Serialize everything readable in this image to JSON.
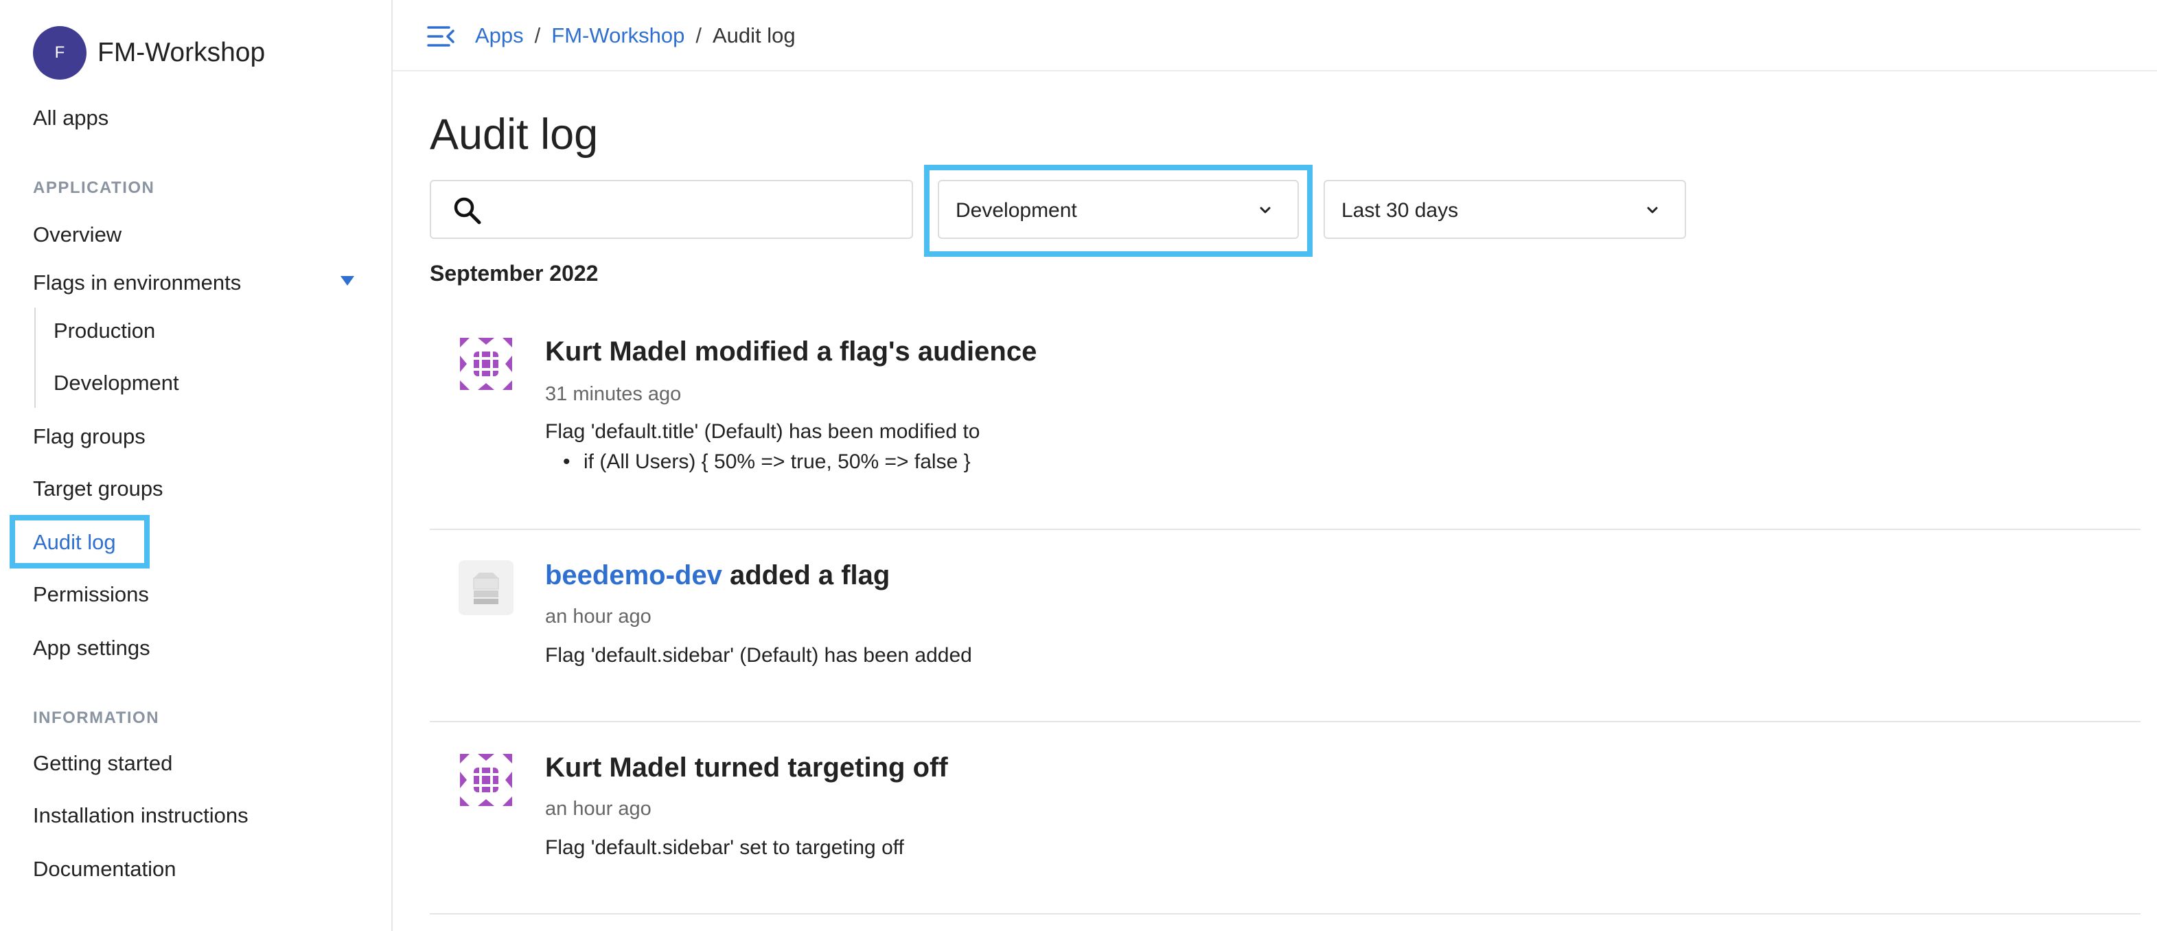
{
  "sidebar": {
    "app_avatar_initial": "F",
    "app_name": "FM-Workshop",
    "all_apps": "All apps",
    "section_application": "APPLICATION",
    "overview": "Overview",
    "flags_in_environments": "Flags in environments",
    "environments": [
      "Production",
      "Development"
    ],
    "flag_groups": "Flag groups",
    "target_groups": "Target groups",
    "audit_log": "Audit log",
    "permissions": "Permissions",
    "app_settings": "App settings",
    "section_information": "INFORMATION",
    "getting_started": "Getting started",
    "installation_instructions": "Installation instructions",
    "documentation": "Documentation"
  },
  "breadcrumb": {
    "apps": "Apps",
    "sep": "/",
    "app": "FM-Workshop",
    "current": "Audit log"
  },
  "page": {
    "title": "Audit log"
  },
  "filters": {
    "search_value": "",
    "environment": "Development",
    "range": "Last 30 days"
  },
  "log": {
    "month": "September 2022",
    "entries": [
      {
        "actor": "",
        "title": "Kurt Madel modified a flag's audience",
        "time": "31 minutes ago",
        "desc": "Flag 'default.title' (Default) has been modified to",
        "bullet": "if (All Users) { 50% => true, 50% => false }"
      },
      {
        "actor": "beedemo-dev",
        "title": " added a flag",
        "time": "an hour ago",
        "desc": "Flag 'default.sidebar' (Default) has been added"
      },
      {
        "actor": "",
        "title": "Kurt Madel turned targeting off",
        "time": "an hour ago",
        "desc": "Flag 'default.sidebar' set to targeting off"
      }
    ]
  },
  "colors": {
    "accent": "#2e6fd0",
    "highlight": "#4bbdf0",
    "avatar": "#3f3c92",
    "identicon": "#a44dc0"
  },
  "icons": {
    "menu": "menu-collapse-icon",
    "search": "search-icon",
    "chevron": "chevron-down-icon",
    "caret": "caret-down-icon"
  }
}
